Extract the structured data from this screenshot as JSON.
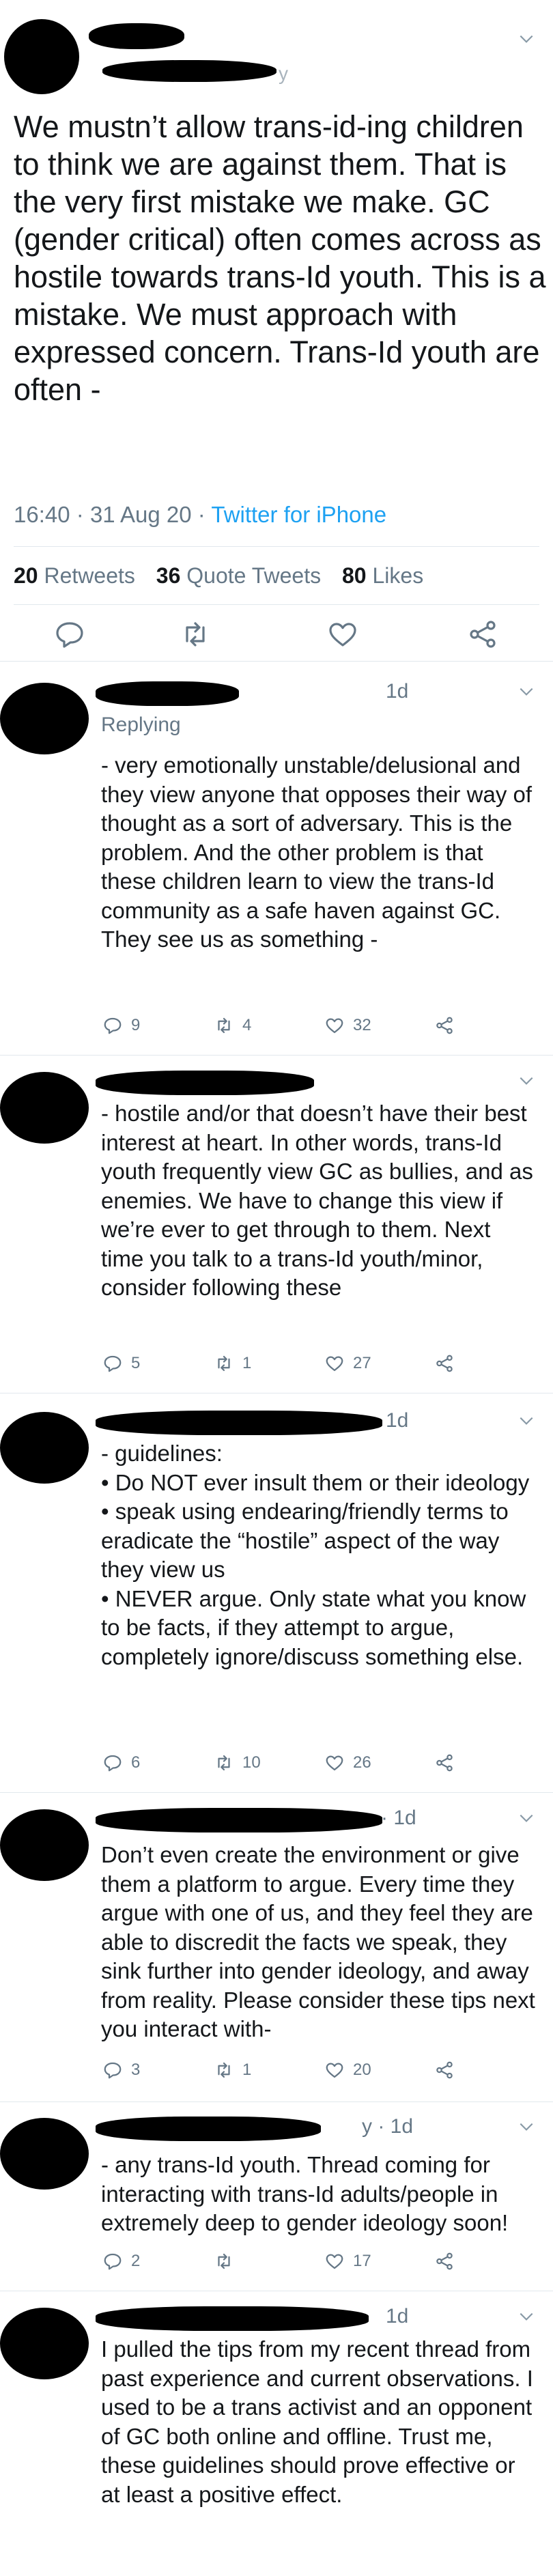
{
  "main_tweet": {
    "handle_suffix": "y",
    "text": "We mustn’t allow trans-id-ing children to think we are against them. That is the very first mistake we make. GC (gender critical) often comes across as hostile towards trans-Id youth. This is a mistake. We must approach with expressed concern. Trans-Id youth are often -",
    "time": "16:40",
    "date": "31 Aug 20",
    "source": "Twitter for iPhone",
    "retweets": "20",
    "retweets_label": "Retweets",
    "quote_tweets": "36",
    "quote_tweets_label": "Quote Tweets",
    "likes": "80",
    "likes_label": "Likes",
    "actions": [
      "reply-icon",
      "retweet-icon",
      "like-icon",
      "share-icon"
    ]
  },
  "replies": [
    {
      "time": "1d",
      "replying_to": "Replying",
      "text": "- very emotionally unstable/delusional and they view anyone that opposes their way of thought as a sort of adversary. This is the problem. And the other problem is that these children learn to view the trans-Id community as a safe haven against GC. They see us as something -",
      "reply_count": "9",
      "retweet_count": "4",
      "like_count": "32"
    },
    {
      "time": "",
      "replying_to": "",
      "text": "- hostile and/or that doesn’t have their best interest at heart. In other words, trans-Id youth frequently view GC as bullies, and as enemies. We have to change this view if we’re ever to get through to them. Next time you talk to a trans-Id youth/minor, consider following these",
      "reply_count": "5",
      "retweet_count": "1",
      "like_count": "27"
    },
    {
      "time": "1d",
      "replying_to": "",
      "text": "- guidelines:\n• Do NOT ever insult them or their ideology\n• speak using endearing/friendly terms to eradicate the “hostile” aspect of the way they view us\n• NEVER argue. Only state what you know to be facts, if they attempt to argue, completely ignore/discuss something else.",
      "reply_count": "6",
      "retweet_count": "10",
      "like_count": "26"
    },
    {
      "time": "· 1d",
      "replying_to": "",
      "text": "Don’t even create the environment or give them a platform to argue. Every time they argue with one of us, and they feel they are able to discredit the facts we speak, they sink further into gender ideology, and away from reality. Please consider these tips next you interact with-",
      "reply_count": "3",
      "retweet_count": "1",
      "like_count": "20"
    },
    {
      "time": "y · 1d",
      "replying_to": "",
      "text": "- any trans-Id youth. Thread coming for interacting with trans-Id adults/people in extremely deep to gender ideology soon!",
      "reply_count": "2",
      "retweet_count": "",
      "like_count": "17"
    },
    {
      "time": "1d",
      "replying_to": "",
      "text": "I pulled the tips from my recent thread from past experience and current observations. I used to be a trans activist and an opponent of GC both online and offline. Trust me, these guidelines should prove effective or at least a positive effect.",
      "reply_count": "",
      "retweet_count": "",
      "like_count": ""
    }
  ],
  "colors": {
    "text": "#14171a",
    "secondary": "#657786",
    "link": "#1da1f2",
    "divider": "#e1e8ed",
    "redaction": "#000000"
  }
}
